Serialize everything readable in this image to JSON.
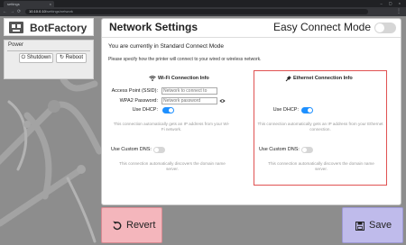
{
  "browser": {
    "tab_title": "settings",
    "tab_close": "×",
    "window_controls": "– ▢ ×",
    "url_host": "10.10.0.10",
    "url_path": "/settings/network",
    "nav_back": "←",
    "nav_forward": "→",
    "nav_reload": "⟳",
    "menu_dots": "⋮"
  },
  "brand": {
    "name": "BotFactory"
  },
  "power": {
    "title": "Power",
    "shutdown_label": "⏻ Shutdown",
    "reboot_label": "↻ Reboot"
  },
  "header": {
    "title": "Network Settings",
    "easy_connect_label": "Easy Connect Mode",
    "easy_connect_on": false
  },
  "main": {
    "mode_text": "You are currently in Standard Connect Mode",
    "specify_text": "Please specify how the printer will connect to your wired or wireless network."
  },
  "wifi": {
    "title": "Wi-Fi Connection Info",
    "icon": "wifi-icon",
    "ssid_label": "Access Point (SSID):",
    "ssid_placeholder": "Network to connect to",
    "ssid_value": "",
    "password_label": "WPA2 Password:",
    "password_placeholder": "Network password",
    "password_value": "",
    "dhcp_label": "Use DHCP:",
    "dhcp_on": true,
    "dhcp_note": "This connection automatically gets an IP address from your Wi-Fi network.",
    "dns_label": "Use Custom DNS:",
    "dns_on": false,
    "dns_note": "This connection automatically discovers the domain name server."
  },
  "ethernet": {
    "title": "Ethernet Connection Info",
    "icon": "plug-icon",
    "dhcp_label": "Use DHCP:",
    "dhcp_on": true,
    "dhcp_note": "This connection automatically gets an IP address from your Ethernet connection.",
    "dns_label": "Use Custom DNS:",
    "dns_on": false,
    "dns_note": "This connection automatically discovers the domain name server."
  },
  "actions": {
    "revert_label": "Revert",
    "save_label": "Save"
  },
  "colors": {
    "accent": "#1e90ff",
    "revert_bg": "#f4b6bc",
    "save_bg": "#bfbbeb",
    "highlight_border": "#e05252"
  }
}
